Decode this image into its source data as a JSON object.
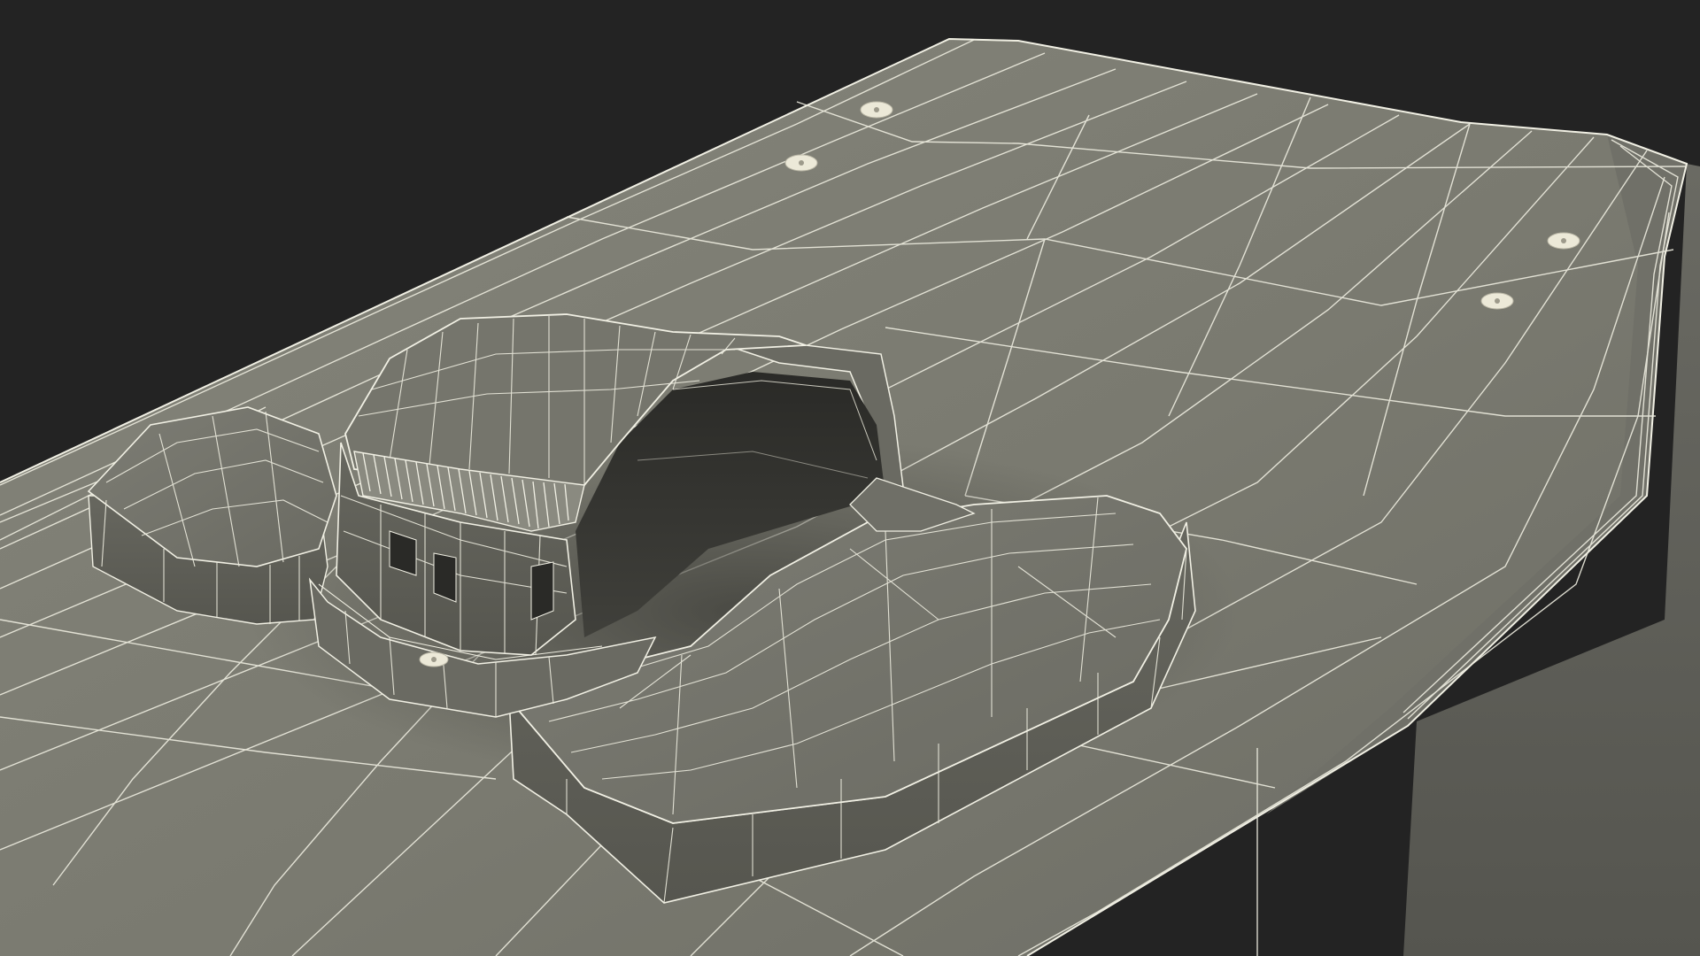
{
  "scene": {
    "background_color": "#232323",
    "board_color": "#7b7b71",
    "board_side_color": "#5e5e57",
    "binding_color": "#6f6f67",
    "binding_dark_color": "#4a4a45",
    "cavity_color": "#1c1c1a",
    "wire_color": "#f1f0e4",
    "screw_color": "#ece9d8",
    "screw_count": 5
  }
}
